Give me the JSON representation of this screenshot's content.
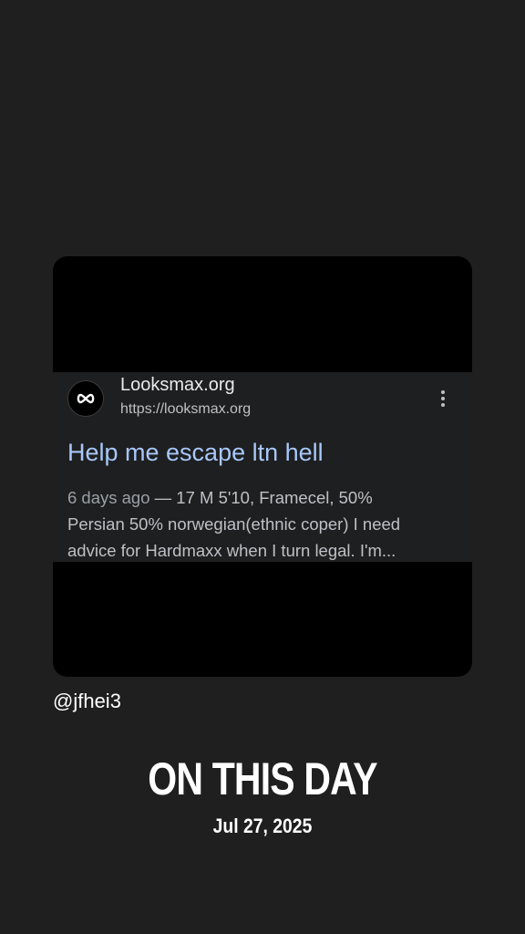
{
  "result": {
    "site_name": "Looksmax.org",
    "site_url": "https://looksmax.org",
    "title": "Help me escape ltn hell",
    "snippet_date": "6 days ago",
    "snippet_separator": " — ",
    "snippet_line1": "17 M 5'10, Framecel, 50%",
    "snippet_line2": "Persian 50% norwegian(ethnic coper) I need",
    "snippet_line3": "advice for Hardmaxx when I turn legal. I'm..."
  },
  "icons": {
    "favicon": "infinity-logo",
    "more": "more-vert-icon"
  },
  "handle": "@jfhei3",
  "memory": {
    "headline": "ON THIS DAY",
    "date": "Jul 27, 2025"
  },
  "colors": {
    "page_bg": "#1f1f1f",
    "result_bg": "#1e1f20",
    "title_link": "#a8c7fa"
  }
}
